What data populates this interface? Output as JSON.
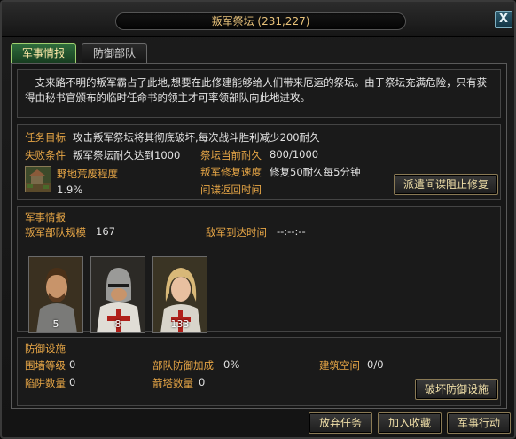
{
  "window": {
    "title": "叛军祭坛 (231,227)",
    "close_glyph": "X"
  },
  "tabs": [
    {
      "label": "军事情报",
      "active": true
    },
    {
      "label": "防御部队",
      "active": false
    }
  ],
  "description": "一支来路不明的叛军霸占了此地,想要在此修建能够给人们带来厄运的祭坛。由于祭坛充满危险，只有获得由秘书官颁布的临时任命书的领主才可率领部队向此地进攻。",
  "mission": {
    "goal_label": "任务目标",
    "goal_text": "攻击叛军祭坛将其彻底破坏,每次战斗胜利减少200耐久",
    "fail_label": "失败条件",
    "fail_text": "叛军祭坛耐久达到1000",
    "durability_label": "祭坛当前耐久",
    "durability_value": "800/1000",
    "wasteland_label": "野地荒废程度",
    "wasteland_value": "1.9%",
    "repair_label": "叛军修复速度",
    "repair_value": "修复50耐久每5分钟",
    "spy_label": "间谍返回时间",
    "spy_button": "派遣间谍阻止修复"
  },
  "intel": {
    "header": "军事情报",
    "scale_label": "叛军部队规模",
    "scale_value": "167",
    "arrival_label": "敌军到达时间",
    "arrival_value": "--:--:--",
    "units": [
      {
        "count": "5"
      },
      {
        "count": "8"
      },
      {
        "count": "133"
      }
    ]
  },
  "defense": {
    "header": "防御设施",
    "wall_label": "围墙等级",
    "wall_value": "0",
    "bonus_label": "部队防御加成",
    "bonus_value": "0%",
    "space_label": "建筑空间",
    "space_value": "0/0",
    "trap_label": "陷阱数量",
    "trap_value": "0",
    "tower_label": "箭塔数量",
    "tower_value": "0",
    "destroy_button": "破坏防御设施"
  },
  "footer": {
    "abandon": "放弃任务",
    "favorite": "加入收藏",
    "action": "军事行动"
  }
}
